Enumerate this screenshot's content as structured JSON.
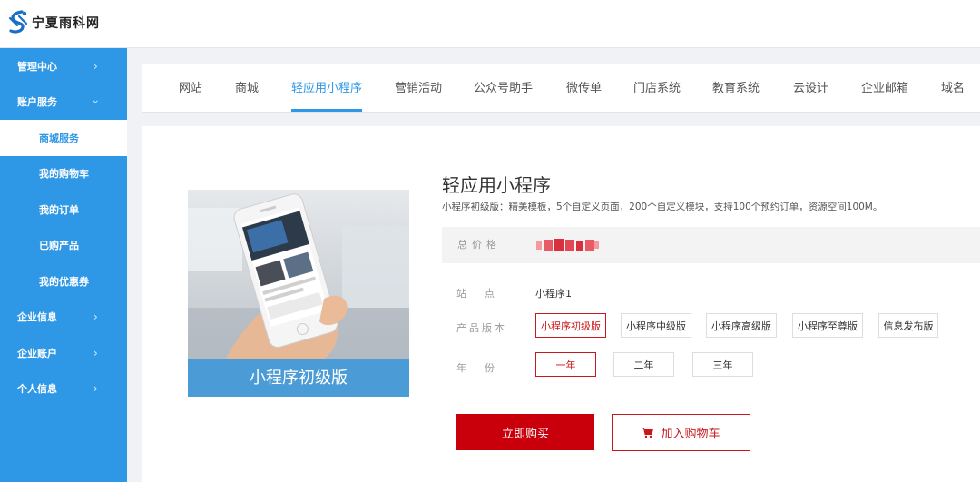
{
  "header": {
    "logo_text": "宁夏雨科网"
  },
  "sidebar": {
    "items": [
      {
        "label": "管理中心",
        "arrow": "chevron-right"
      },
      {
        "label": "账户服务",
        "arrow": "chevron-down"
      },
      {
        "label": "商城服务",
        "active": true
      },
      {
        "label": "我的购物车"
      },
      {
        "label": "我的订单"
      },
      {
        "label": "已购产品"
      },
      {
        "label": "我的优惠券"
      },
      {
        "label": "企业信息",
        "arrow": "chevron-right"
      },
      {
        "label": "企业账户",
        "arrow": "chevron-right"
      },
      {
        "label": "个人信息",
        "arrow": "chevron-right"
      }
    ],
    "arrow_right": "›",
    "arrow_down": "›"
  },
  "tabs": [
    {
      "label": "网站"
    },
    {
      "label": "商城"
    },
    {
      "label": "轻应用小程序",
      "active": true
    },
    {
      "label": "营销活动"
    },
    {
      "label": "公众号助手"
    },
    {
      "label": "微传单"
    },
    {
      "label": "门店系统"
    },
    {
      "label": "教育系统"
    },
    {
      "label": "云设计"
    },
    {
      "label": "企业邮箱"
    },
    {
      "label": "域名"
    }
  ],
  "product": {
    "image_caption": "小程序初级版",
    "title": "轻应用小程序",
    "description": "小程序初级版：精美模板，5个自定义页面，200个自定义模块，支持100个预约订单，资源空间100M。",
    "price_label": "总价格",
    "price_value_obscured": true,
    "site_label": "站点",
    "site_value": "小程序1",
    "version_label": "产品版本",
    "versions": [
      {
        "label": "小程序初级版",
        "selected": true
      },
      {
        "label": "小程序中级版"
      },
      {
        "label": "小程序高级版"
      },
      {
        "label": "小程序至尊版"
      },
      {
        "label": "信息发布版"
      }
    ],
    "year_label": "年份",
    "years": [
      {
        "label": "一年",
        "selected": true
      },
      {
        "label": "二年"
      },
      {
        "label": "三年"
      }
    ],
    "buy_label": "立即购买",
    "cart_label": "加入购物车"
  },
  "colors": {
    "sidebar": "#2e97e6",
    "accent_blue": "#2e97e6",
    "accent_red": "#c9000b"
  }
}
